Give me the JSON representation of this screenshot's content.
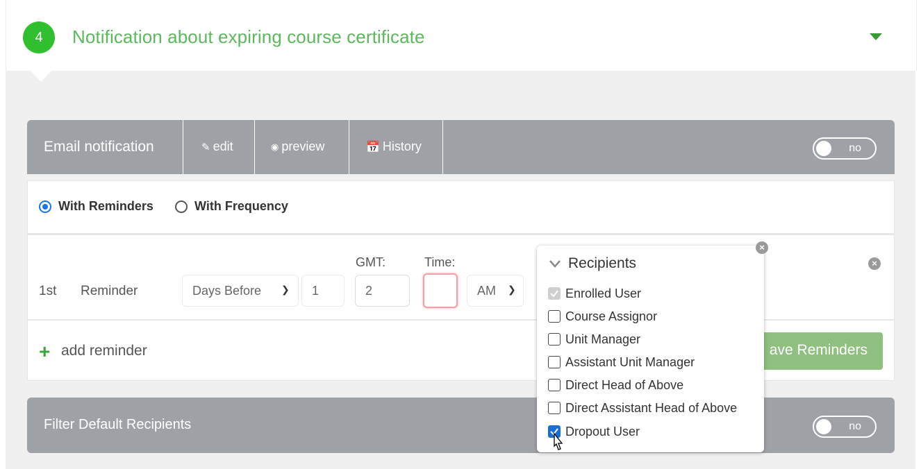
{
  "step": {
    "number": "4",
    "title": "Notification about expiring course certificate"
  },
  "email_bar": {
    "label": "Email notification",
    "edit_label": "edit",
    "preview_label": "preview",
    "history_label": "History",
    "toggle_label": "no"
  },
  "mode": {
    "option1": "With Reminders",
    "option2": "With Frequency",
    "selected": "With Reminders"
  },
  "reminder": {
    "ordinal": "1st",
    "label": "Reminder",
    "when": "Days Before",
    "days": "1",
    "gmt_label": "GMT:",
    "gmt": "2",
    "time_label": "Time:",
    "time": "",
    "ampm": "AM"
  },
  "actions": {
    "add_reminder": "add reminder",
    "save_reminders": "ave Reminders"
  },
  "filter_bar": {
    "label": "Filter Default Recipients",
    "toggle_label": "no"
  },
  "recipients_popup": {
    "title": "Recipients",
    "items": [
      {
        "label": "Enrolled User",
        "state": "checked-disabled"
      },
      {
        "label": "Course Assignor",
        "state": "unchecked"
      },
      {
        "label": "Unit Manager",
        "state": "unchecked"
      },
      {
        "label": "Assistant Unit Manager",
        "state": "unchecked"
      },
      {
        "label": "Direct Head of Above",
        "state": "unchecked"
      },
      {
        "label": "Direct Assistant Head of Above",
        "state": "unchecked"
      },
      {
        "label": "Dropout User",
        "state": "checked"
      }
    ]
  },
  "colors": {
    "accent_green": "#5cb85c",
    "step_circle": "#2fbf2f",
    "bar_gray": "#9ea1a6",
    "radio_blue": "#1a73e8",
    "save_button": "#8fc07f",
    "time_field_border": "#f2a0a8"
  }
}
